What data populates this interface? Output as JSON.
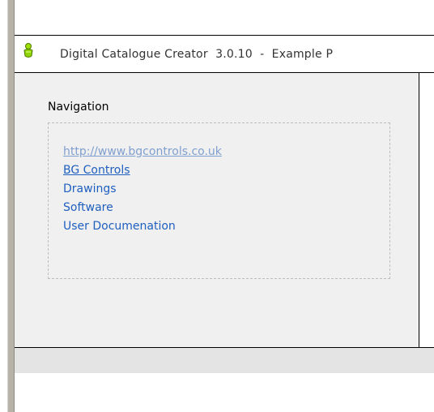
{
  "window": {
    "title": "Digital Catalogue Creator  3.0.10  -  Example P"
  },
  "navigation": {
    "heading": "Navigation",
    "links": [
      {
        "label": "http://www.bgcontrols.co.uk",
        "state": "visited"
      },
      {
        "label": "BG Controls",
        "state": "underlined"
      },
      {
        "label": "Drawings",
        "state": "normal"
      },
      {
        "label": "Software",
        "state": "normal"
      },
      {
        "label": "User Documenation",
        "state": "normal"
      }
    ]
  },
  "colors": {
    "link": "#1f5fbf",
    "visited_link": "#7f9fcf",
    "content_bg": "#f0f0f0",
    "icon_green": "#8fd400"
  },
  "icons": {
    "app": "app-logo-icon"
  }
}
